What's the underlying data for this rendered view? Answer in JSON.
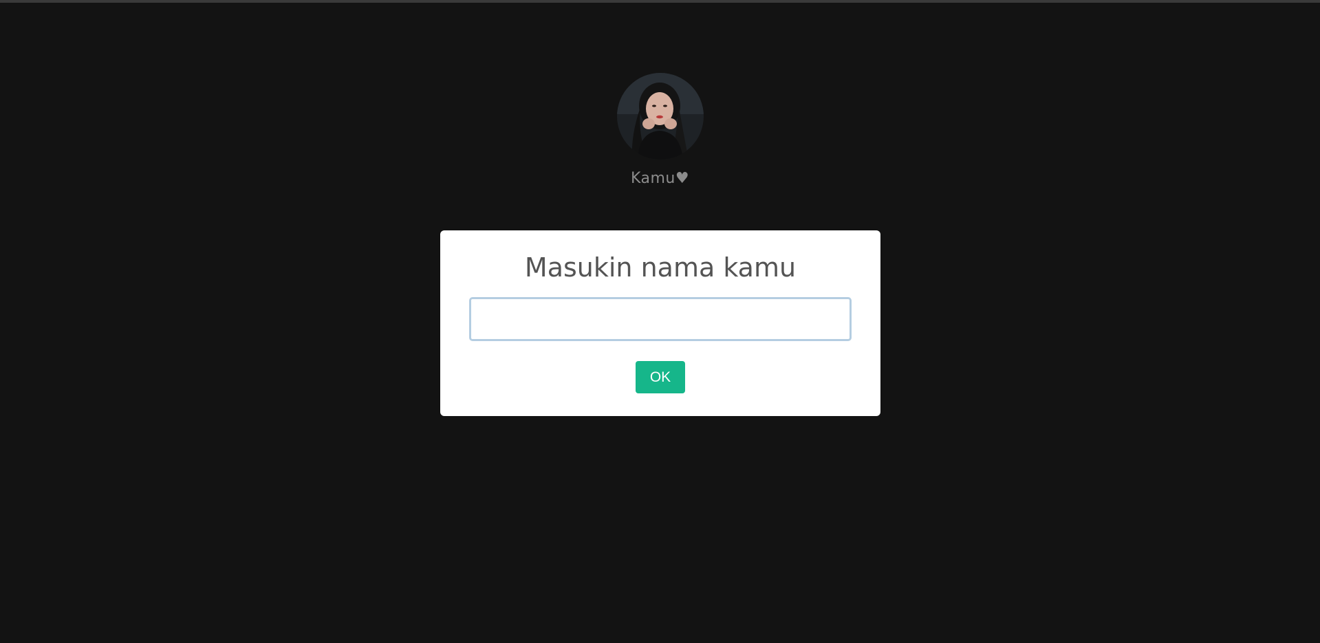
{
  "profile": {
    "name": "Kamu♥",
    "avatar_alt": "profile photo"
  },
  "dialog": {
    "title": "Masukin nama kamu",
    "input_value": "",
    "input_placeholder": "",
    "confirm_label": "OK"
  },
  "colors": {
    "page_background": "#131313",
    "dialog_background": "#ffffff",
    "confirm_button": "#16b68a",
    "input_focus_border": "#b4cde1",
    "title_text": "#545454",
    "profile_name_text": "#8c8c8c"
  }
}
